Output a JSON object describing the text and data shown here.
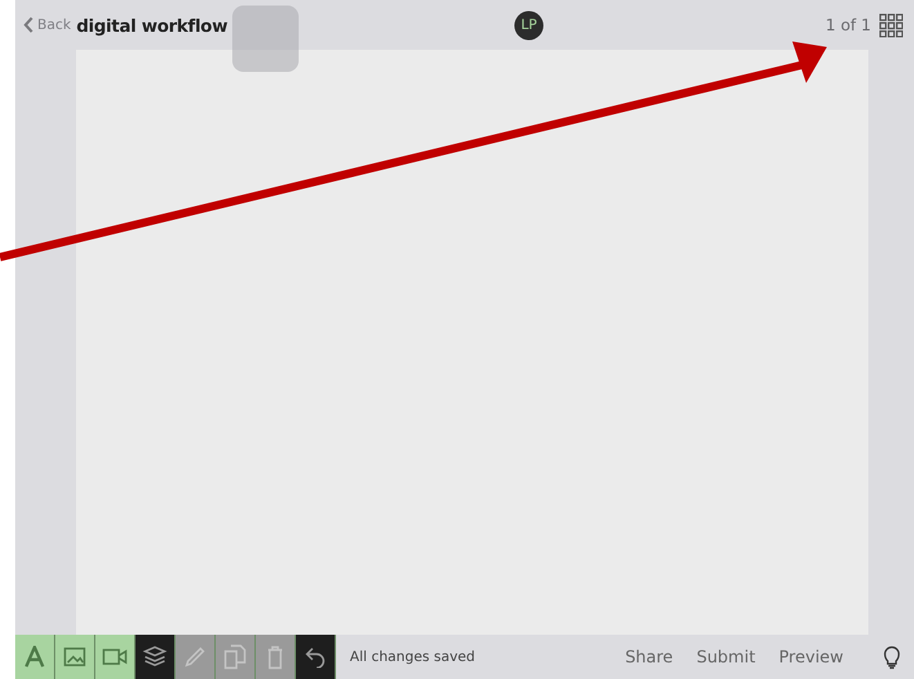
{
  "header": {
    "back": "Back",
    "title": "digital workflow",
    "avatar": "LP",
    "page_count": "1 of 1"
  },
  "tools": [
    {
      "kind": "text",
      "color": "#a8d4a0"
    },
    {
      "kind": "image",
      "color": "#a8d4a0"
    },
    {
      "kind": "video",
      "color": "#a8d4a0"
    },
    {
      "kind": "layers",
      "color": "#1e1e1e"
    },
    {
      "kind": "pencil",
      "color": "#9a9a9a"
    },
    {
      "kind": "copy",
      "color": "#9a9a9a"
    },
    {
      "kind": "trash",
      "color": "#9a9a9a"
    },
    {
      "kind": "undo",
      "color": "#1e1e1e"
    }
  ],
  "status": "All changes saved",
  "actions": [
    "Share",
    "Submit",
    "Preview"
  ]
}
